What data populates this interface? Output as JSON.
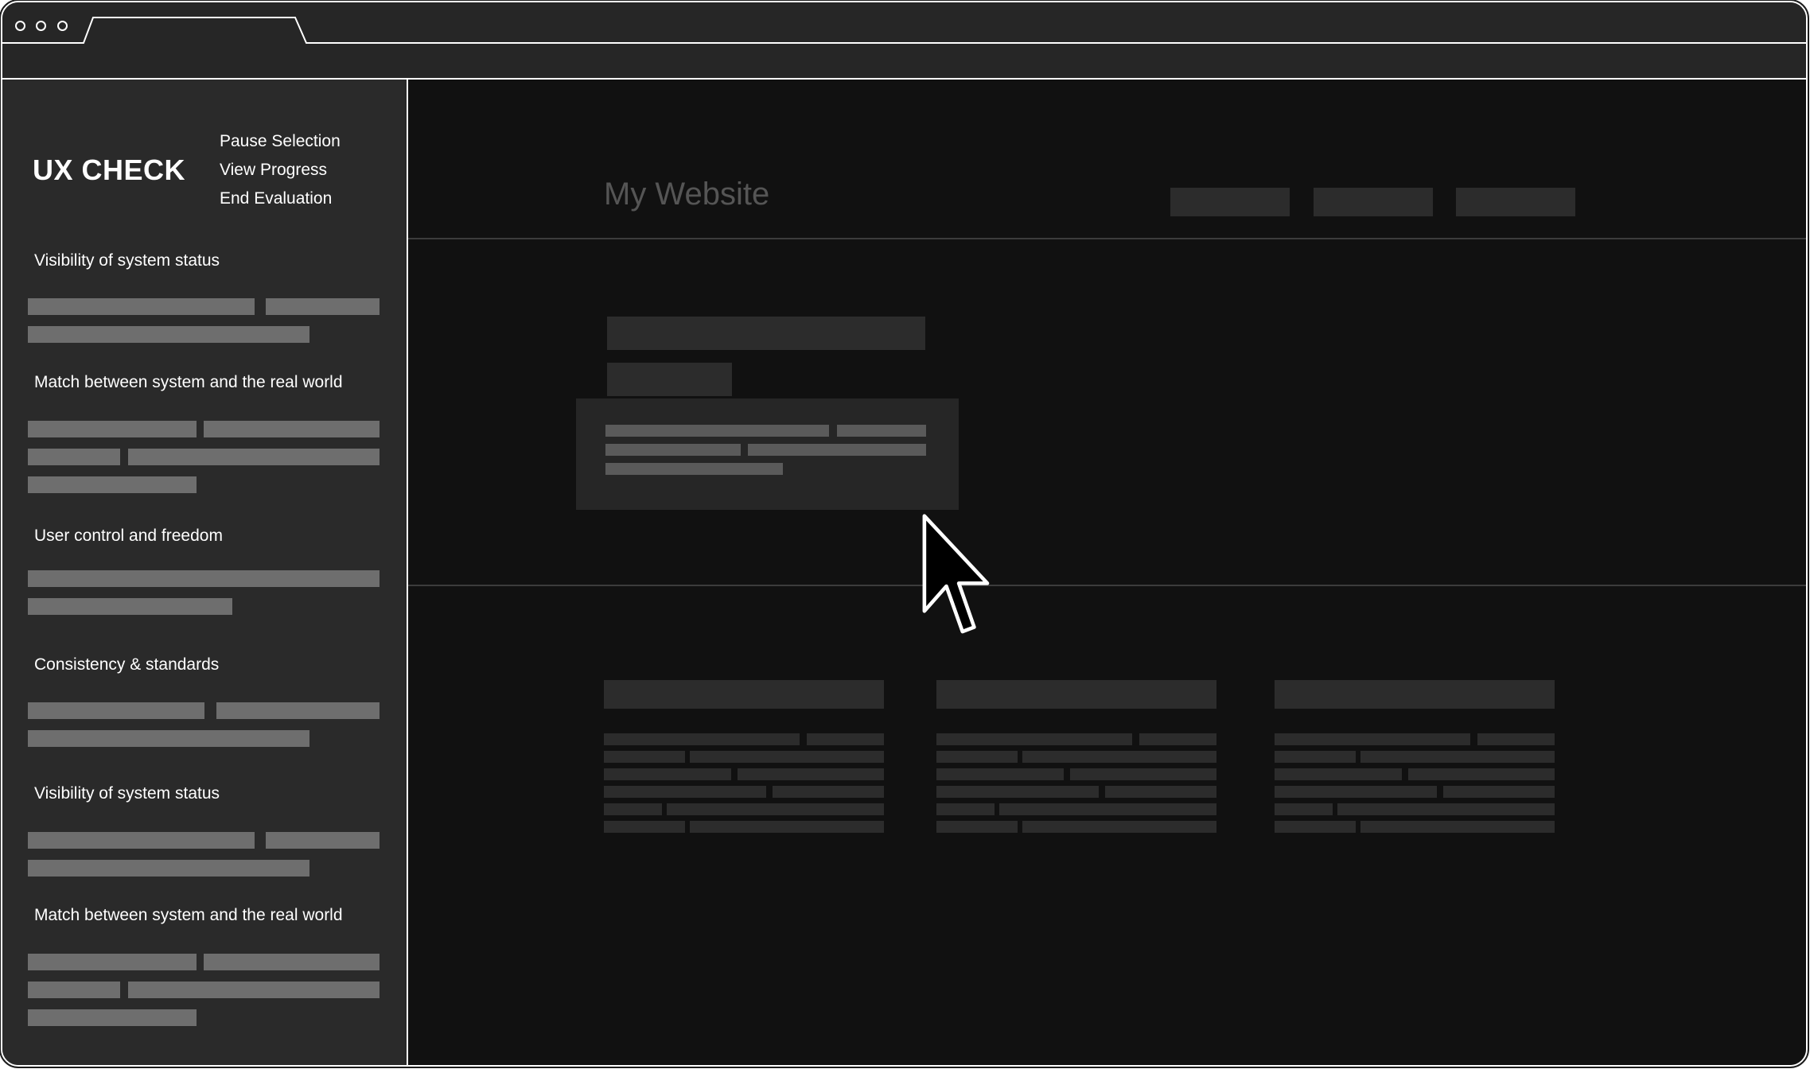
{
  "sidebar": {
    "brand": "UX CHECK",
    "menu": [
      {
        "label": "Pause Selection"
      },
      {
        "label": "View Progress"
      },
      {
        "label": "End Evaluation"
      }
    ],
    "heuristics": [
      {
        "title": "Visibility of system status"
      },
      {
        "title": "Match between system and the real world"
      },
      {
        "title": "User control and freedom"
      },
      {
        "title": "Consistency & standards"
      },
      {
        "title": "Visibility of system status"
      },
      {
        "title": "Match between system and the real world"
      }
    ]
  },
  "website": {
    "title": "My Website"
  },
  "icons": {
    "window_controls": "traffic-light-dots",
    "cursor": "arrow-pointer-icon"
  },
  "colors": {
    "sidebar_bg": "#2a2a2a",
    "content_bg": "#111111",
    "text": "#ffffff",
    "placeholder_bar": "#6e6e6e"
  }
}
